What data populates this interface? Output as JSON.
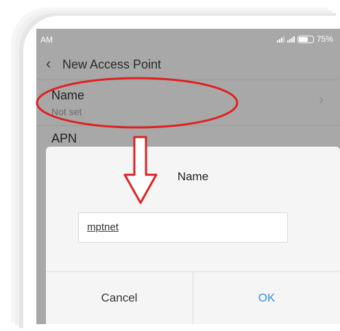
{
  "status_bar": {
    "time": "AM",
    "battery_text": "75%",
    "battery_level": 0.75
  },
  "header": {
    "title": "New Access Point",
    "back_icon": "chevron-left-icon"
  },
  "settings": [
    {
      "title": "Name",
      "subtitle": "Not set",
      "chevron_icon": "chevron-right-icon"
    },
    {
      "title": "APN"
    }
  ],
  "dialog": {
    "title": "Name",
    "input_value": "mptnet",
    "cancel_label": "Cancel",
    "ok_label": "OK"
  },
  "colors": {
    "dimmed_background": "#a8a8a8",
    "dialog_background": "#f5f5f5",
    "ok_accent": "#2f8fe0",
    "annotation_red": "#e02020"
  }
}
